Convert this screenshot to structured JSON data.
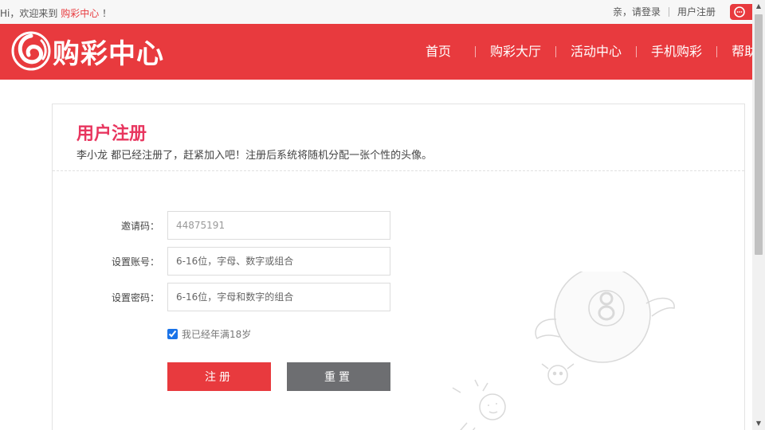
{
  "topbar": {
    "greeting_prefix": "Hi，欢迎来到",
    "site_name": "购彩中心",
    "greeting_suffix": "！",
    "login_link": "亲，请登录",
    "register_link": "用户注册",
    "service_icon": "headset-chat-icon"
  },
  "header": {
    "logo_text": "购彩中心",
    "logo_icon": "swirl-logo-icon",
    "nav": [
      "首页",
      "购彩大厅",
      "活动中心",
      "手机购彩",
      "帮助"
    ]
  },
  "form": {
    "title": "用户注册",
    "subtitle": "李小龙 都已经注册了，赶紧加入吧！注册后系统将随机分配一张个性的头像。",
    "invite_label": "邀请码：",
    "invite_value": "44875191",
    "account_label": "设置账号：",
    "account_placeholder": "6-16位，字母、数字或组合",
    "password_label": "设置密码：",
    "password_placeholder": "6-16位，字母和数字的组合",
    "agree_text": "我已经年满18岁",
    "agree_checked": true,
    "submit_label": "注册",
    "reset_label": "重置"
  },
  "colors": {
    "brand_red": "#e83a3e",
    "title_pink": "#e8365f",
    "reset_gray": "#6d6e71"
  }
}
